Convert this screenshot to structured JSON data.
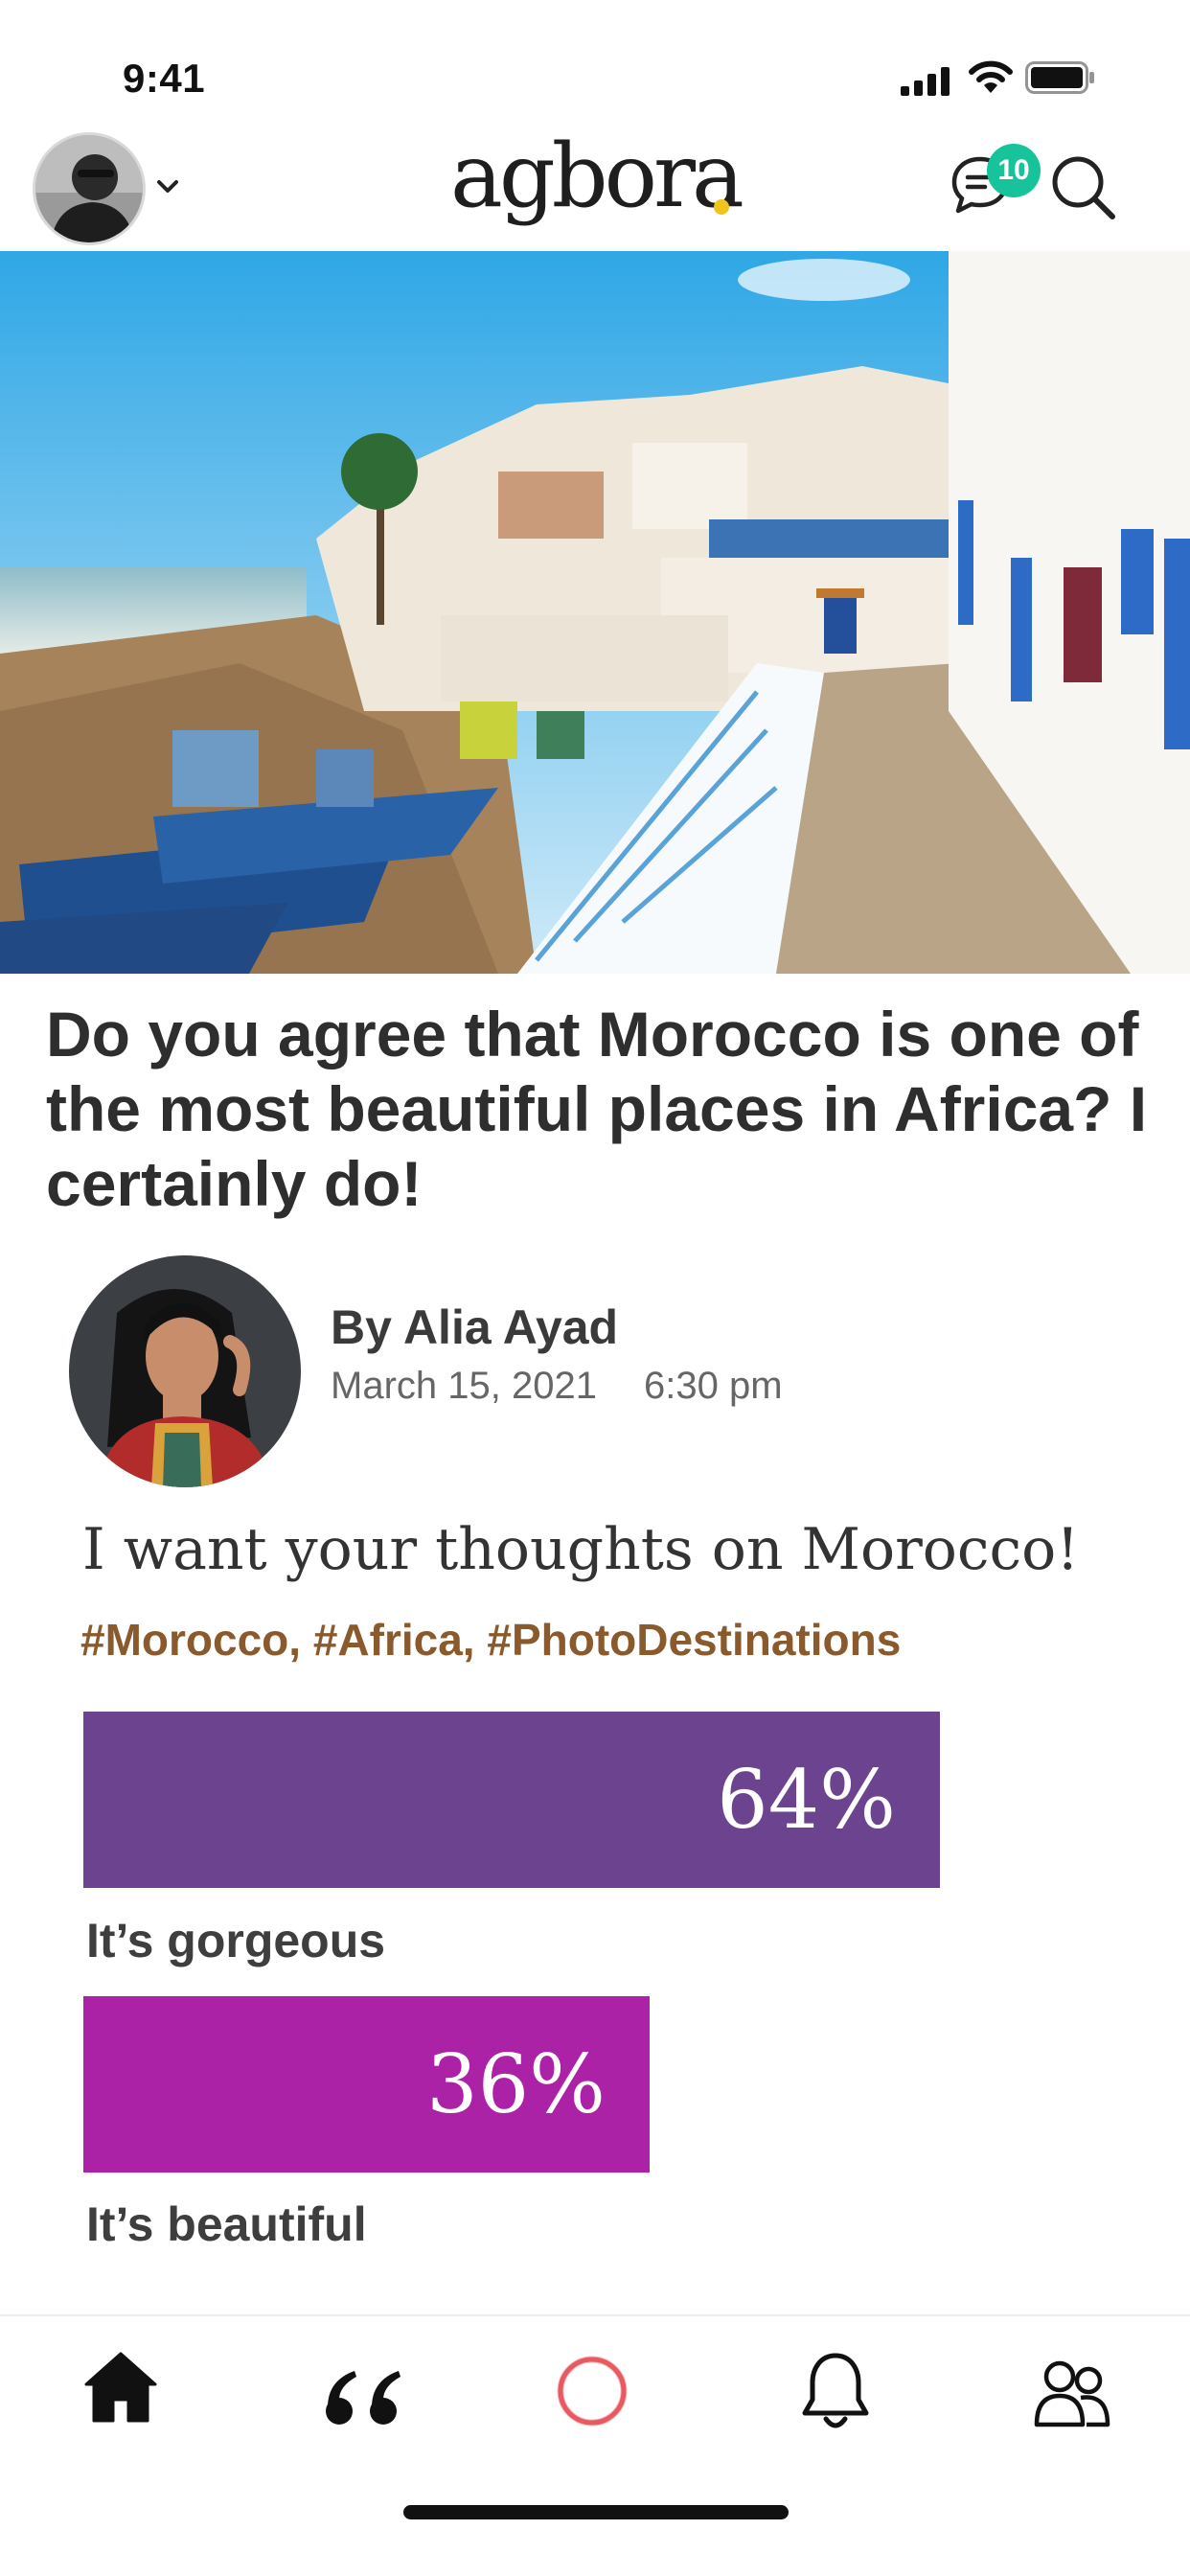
{
  "status_bar": {
    "time": "9:41"
  },
  "header": {
    "logo": "agbora",
    "message_count": "10"
  },
  "post": {
    "headline": "Do you agree that Morocco is one of the most beautiful places in Africa? I certainly do!",
    "author": "By Alia Ayad",
    "date": "March 15, 2021",
    "time": "6:30 pm",
    "body": "I want your thoughts on Morocco!",
    "hashtags": "#Morocco, #Africa, #PhotoDestinations"
  },
  "poll": {
    "options": [
      {
        "label": "It’s gorgeous",
        "percent_text": "64%",
        "value": 64,
        "color": "#6b438e"
      },
      {
        "label": "It’s beautiful",
        "percent_text": "36%",
        "value": 36,
        "color": "#ab22a6"
      }
    ]
  },
  "colors": {
    "accent_teal": "#17c39a",
    "hashtag_brown": "#8a5a2c",
    "record_red": "#e85a62",
    "logo_dot": "#f0c419"
  },
  "nav": {
    "icons": [
      "home-icon",
      "quote-icon",
      "record-icon",
      "bell-icon",
      "people-icon"
    ]
  }
}
